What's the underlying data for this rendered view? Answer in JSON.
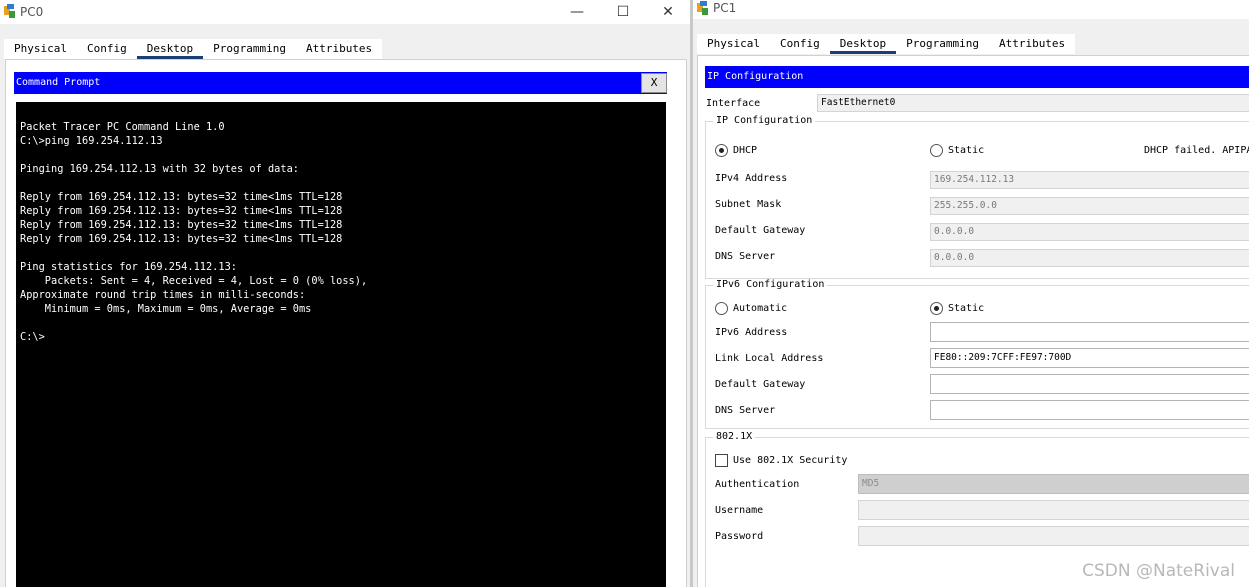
{
  "pc0": {
    "title": "PC0",
    "controls": {
      "minimize": "—",
      "maximize": "☐",
      "close": "✕"
    },
    "tabs": [
      "Physical",
      "Config",
      "Desktop",
      "Programming",
      "Attributes"
    ],
    "active_tab": "Desktop",
    "cmd": {
      "title": "Command Prompt",
      "close_label": "X",
      "output": "Packet Tracer PC Command Line 1.0\nC:\\>ping 169.254.112.13\n\nPinging 169.254.112.13 with 32 bytes of data:\n\nReply from 169.254.112.13: bytes=32 time<1ms TTL=128\nReply from 169.254.112.13: bytes=32 time<1ms TTL=128\nReply from 169.254.112.13: bytes=32 time<1ms TTL=128\nReply from 169.254.112.13: bytes=32 time<1ms TTL=128\n\nPing statistics for 169.254.112.13:\n    Packets: Sent = 4, Received = 4, Lost = 0 (0% loss),\nApproximate round trip times in milli-seconds:\n    Minimum = 0ms, Maximum = 0ms, Average = 0ms\n\nC:\\>"
    }
  },
  "pc1": {
    "title": "PC1",
    "tabs": [
      "Physical",
      "Config",
      "Desktop",
      "Programming",
      "Attributes"
    ],
    "active_tab": "Desktop",
    "ipconfig": {
      "title": "IP Configuration",
      "interface_label": "Interface",
      "interface_value": "FastEthernet0",
      "ipv4_group": "IP Configuration",
      "dhcp_label": "DHCP",
      "static_label": "Static",
      "ipv4_mode": "DHCP",
      "status": "DHCP failed. APIPA",
      "ipv4_address_label": "IPv4 Address",
      "ipv4_address": "169.254.112.13",
      "subnet_mask_label": "Subnet Mask",
      "subnet_mask": "255.255.0.0",
      "default_gateway_label": "Default Gateway",
      "default_gateway": "0.0.0.0",
      "dns_server_label": "DNS Server",
      "dns_server": "0.0.0.0",
      "ipv6_group": "IPv6 Configuration",
      "automatic_label": "Automatic",
      "static6_label": "Static",
      "ipv6_mode": "Static",
      "ipv6_address_label": "IPv6 Address",
      "ipv6_address": "",
      "link_local_label": "Link Local Address",
      "link_local": "FE80::209:7CFF:FE97:700D",
      "ipv6_gateway_label": "Default Gateway",
      "ipv6_gateway": "",
      "ipv6_dns_label": "DNS Server",
      "ipv6_dns": "",
      "dot1x_group": "802.1X",
      "dot1x_checkbox_label": "Use 802.1X Security",
      "dot1x_enabled": false,
      "authentication_label": "Authentication",
      "authentication": "MD5",
      "username_label": "Username",
      "username": "",
      "password_label": "Password",
      "password": ""
    }
  },
  "watermark": "CSDN @NateRival",
  "colors": {
    "title_bar_blue": "#0000ff",
    "tab_underline": "#1c3f73",
    "console_bg": "#000000"
  }
}
